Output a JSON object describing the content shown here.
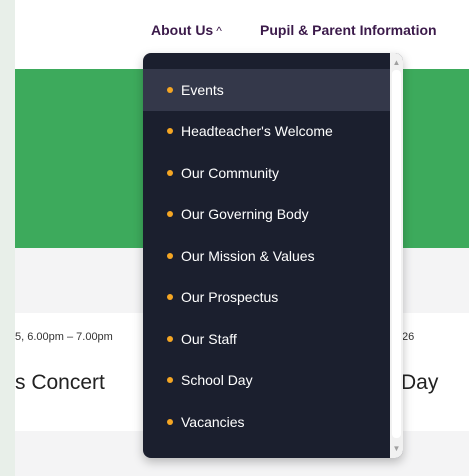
{
  "nav": {
    "about_label": "About Us",
    "about_chevron": "^",
    "pupil_label": "Pupil & Parent Information"
  },
  "events": {
    "left_date": "5, 6.00pm – 7.00pm",
    "left_title": "s Concert",
    "right_date": "26",
    "right_title": "Day"
  },
  "dropdown": {
    "items": [
      {
        "label": "Events"
      },
      {
        "label": "Headteacher's Welcome"
      },
      {
        "label": "Our Community"
      },
      {
        "label": "Our Governing Body"
      },
      {
        "label": "Our Mission & Values"
      },
      {
        "label": "Our Prospectus"
      },
      {
        "label": "Our Staff"
      },
      {
        "label": "School Day"
      },
      {
        "label": "Vacancies"
      }
    ],
    "active_item": "Events",
    "bullet_color": "#f5a623",
    "background_color": "#1b1f2e"
  },
  "colors": {
    "hero_green": "#3daa5c",
    "nav_text": "#3b1a4a",
    "page_border": "#e8efe9"
  }
}
